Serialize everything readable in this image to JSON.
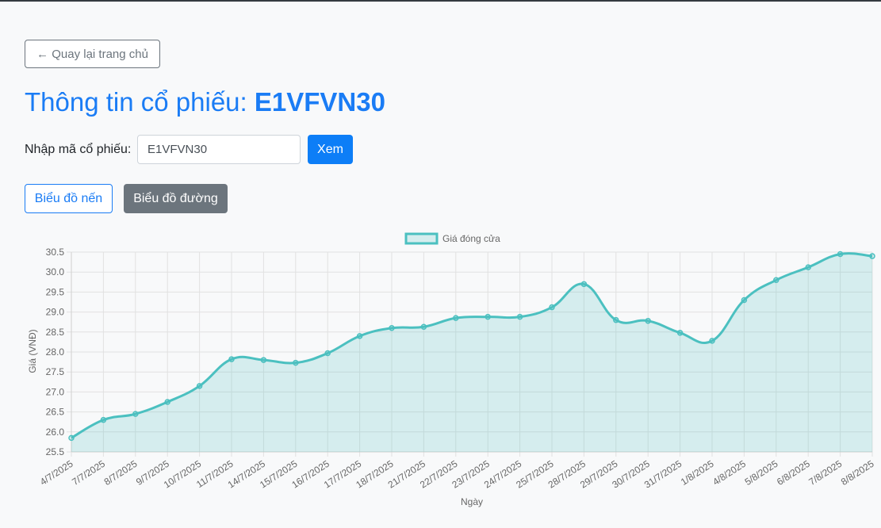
{
  "nav": {
    "back_label": "← Quay lại trang chủ"
  },
  "header": {
    "title_prefix": "Thông tin cổ phiếu: ",
    "stock_code": "E1VFVN30"
  },
  "search": {
    "label": "Nhập mã cổ phiếu:",
    "value": "E1VFVN30",
    "button_label": "Xem"
  },
  "chart_tabs": {
    "candle_label": "Biểu đồ nến",
    "line_label": "Biểu đồ đường",
    "active": "line"
  },
  "colors": {
    "accent": "#1a7cf5",
    "line": "#4bc0c0",
    "fill": "rgba(75,192,192,0.2)"
  },
  "chart_data": {
    "type": "area",
    "xlabel": "Ngày",
    "ylabel": "Giá (VNĐ)",
    "ylim": [
      25.5,
      30.5
    ],
    "yticks": [
      25.5,
      26.0,
      26.5,
      27.0,
      27.5,
      28.0,
      28.5,
      29.0,
      29.5,
      30.0,
      30.5
    ],
    "grid": true,
    "legend_position": "top",
    "categories": [
      "4/7/2025",
      "7/7/2025",
      "8/7/2025",
      "9/7/2025",
      "10/7/2025",
      "11/7/2025",
      "14/7/2025",
      "15/7/2025",
      "16/7/2025",
      "17/7/2025",
      "18/7/2025",
      "21/7/2025",
      "22/7/2025",
      "23/7/2025",
      "24/7/2025",
      "25/7/2025",
      "28/7/2025",
      "29/7/2025",
      "30/7/2025",
      "31/7/2025",
      "1/8/2025",
      "4/8/2025",
      "5/8/2025",
      "6/8/2025",
      "7/8/2025",
      "8/8/2025"
    ],
    "series": [
      {
        "name": "Giá đóng cửa",
        "values": [
          25.85,
          26.3,
          26.45,
          26.75,
          27.15,
          27.82,
          27.8,
          27.73,
          27.97,
          28.4,
          28.6,
          28.63,
          28.85,
          28.88,
          28.88,
          29.12,
          29.7,
          28.8,
          28.78,
          28.48,
          28.28,
          29.3,
          29.8,
          30.12,
          30.45,
          30.4
        ]
      }
    ]
  }
}
